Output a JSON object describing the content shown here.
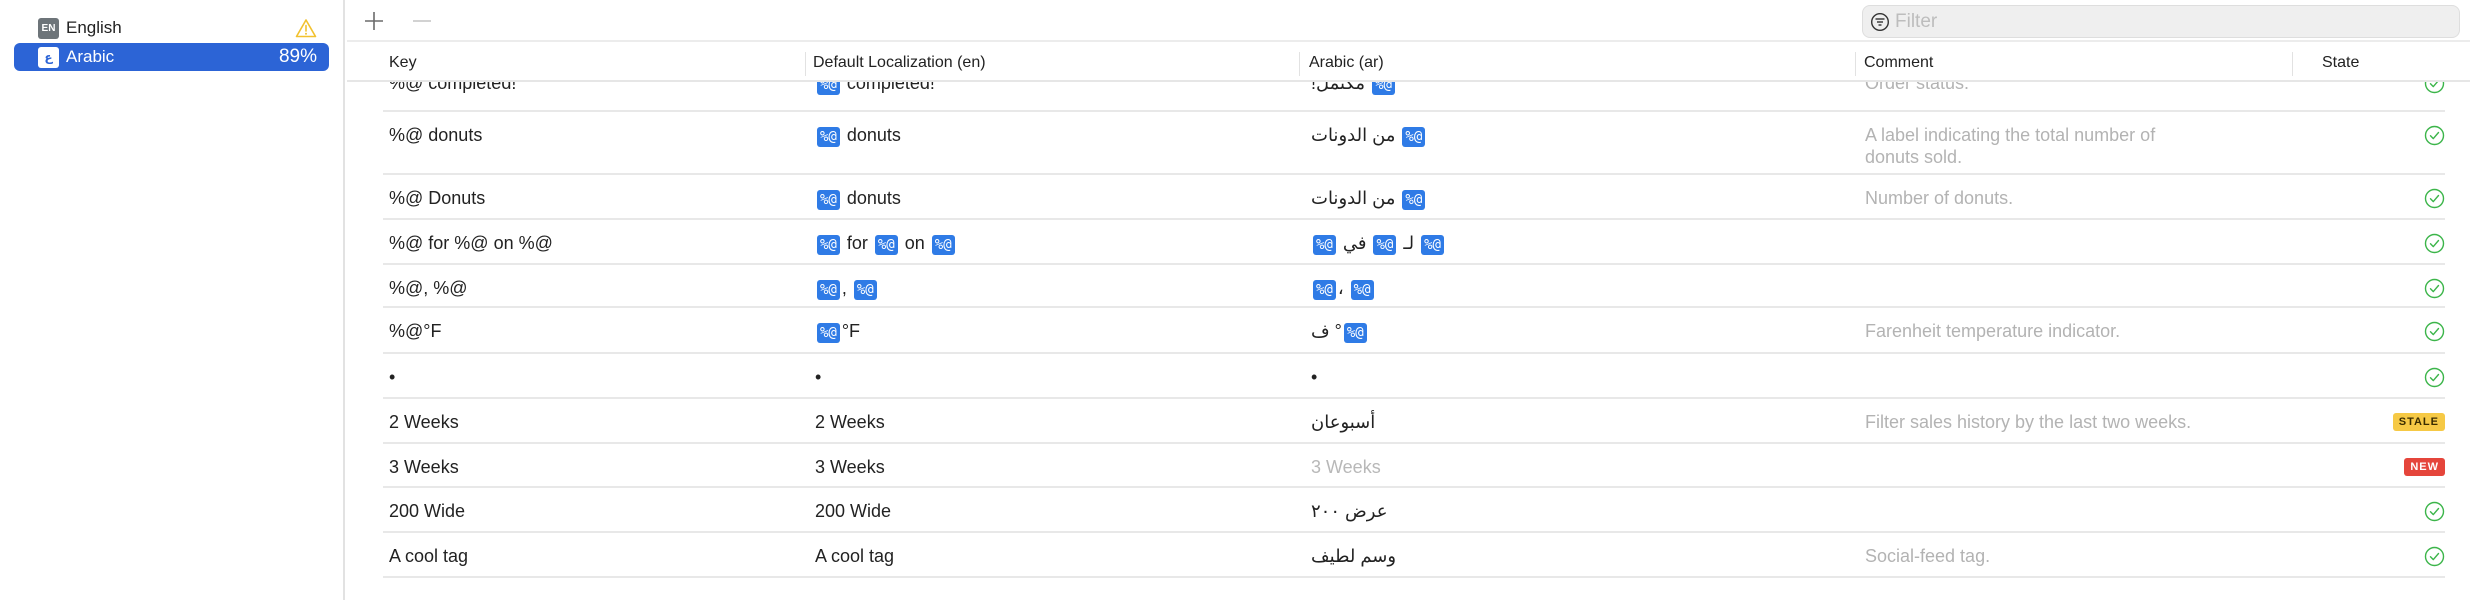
{
  "sidebar": {
    "languages": [
      {
        "code_badge": "EN",
        "name": "English",
        "status_icon": "warning-icon"
      },
      {
        "code_badge": "ع",
        "name": "Arabic",
        "progress": "89%",
        "selected": true
      }
    ]
  },
  "toolbar": {
    "add_icon": "plus-icon",
    "remove_icon": "minus-icon",
    "filter": {
      "placeholder": "Filter",
      "value": "",
      "icon": "filter-circle-icon"
    }
  },
  "table": {
    "columns": [
      "Key",
      "Default Localization (en)",
      "Arabic (ar)",
      "Comment",
      "State"
    ],
    "rows": [
      {
        "key": "%@ completed!",
        "default": [
          "{ph}",
          " completed!"
        ],
        "arabic": [
          "{ph}",
          " مكتمل!"
        ],
        "comment": "Order status.",
        "state": "translated"
      },
      {
        "key": "%@ donuts",
        "default": [
          "{ph}",
          " donuts"
        ],
        "arabic": [
          "{ph}",
          " من الدونات"
        ],
        "comment": "A label indicating the total number of donuts sold.",
        "state": "translated"
      },
      {
        "key": "%@ Donuts",
        "default": [
          "{ph}",
          " donuts"
        ],
        "arabic": [
          "{ph}",
          " من الدونات"
        ],
        "comment": "Number of donuts.",
        "state": "translated"
      },
      {
        "key": "%@ for %@ on %@",
        "default": [
          "{ph}",
          " for ",
          "{ph}",
          " on ",
          "{ph}"
        ],
        "arabic": [
          "{ph}",
          " لـ ",
          "{ph}",
          " في ",
          "{ph}"
        ],
        "comment": "",
        "state": "translated"
      },
      {
        "key": "%@, %@",
        "default": [
          "{ph}",
          ", ",
          "{ph}"
        ],
        "arabic": [
          "{ph}",
          "، ",
          "{ph}"
        ],
        "comment": "",
        "state": "translated"
      },
      {
        "key": "%@°F",
        "default": [
          "{ph}",
          "°F"
        ],
        "arabic": [
          "{ph}",
          "° ف"
        ],
        "comment": "Farenheit temperature indicator.",
        "state": "translated"
      },
      {
        "key": "•",
        "default": [
          "•"
        ],
        "arabic": [
          "•"
        ],
        "comment": "",
        "state": "translated"
      },
      {
        "key": "2 Weeks",
        "default": [
          "2 Weeks"
        ],
        "arabic": [
          "أسبوعان"
        ],
        "comment": "Filter sales history by the last two weeks.",
        "state": "stale"
      },
      {
        "key": "3 Weeks",
        "default": [
          "3 Weeks"
        ],
        "arabic": [
          "3 Weeks"
        ],
        "comment": "",
        "state": "new",
        "untranslated": true
      },
      {
        "key": "200 Wide",
        "default": [
          "200 Wide"
        ],
        "arabic": [
          "عرض ٢٠٠"
        ],
        "comment": "",
        "state": "translated"
      },
      {
        "key": "A cool tag",
        "default": [
          "A cool tag"
        ],
        "arabic": [
          "وسم لطيف"
        ],
        "comment": "Social-feed tag.",
        "state": "translated"
      }
    ],
    "placeholder_token": "%@",
    "state_labels": {
      "stale": "STALE",
      "new": "NEW"
    }
  },
  "colors": {
    "accent": "#2c64d6",
    "placeholder_chip": "#2f7be6",
    "translated": "#3cb54a",
    "stale": "#f6c945",
    "new": "#e5453b",
    "warning": "#f2c12e"
  }
}
